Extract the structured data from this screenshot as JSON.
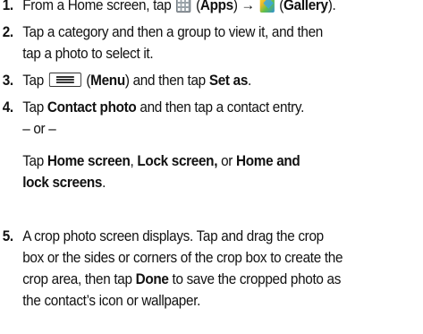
{
  "steps": [
    {
      "num": "1.",
      "lines": [
        "From a Home screen, tap",
        "(Apps) →",
        "(Gallery)."
      ],
      "apps": "Apps",
      "gallery": "Gallery"
    },
    {
      "num": "2.",
      "line1": "Tap a category and then a group to view it, and then",
      "line2": "tap a photo to select it."
    },
    {
      "num": "3.",
      "pre": "Tap",
      "menu": "Menu",
      "post": "and then tap",
      "set_as": "Set as"
    },
    {
      "num": "4.",
      "pre": "Tap",
      "contact_photo": "Contact photo",
      "post": "and then tap a contact entry.",
      "or": "– or –",
      "alt_pre": "Tap",
      "home_screen": "Home screen",
      "lock_screen": "Lock screen,",
      "or_word": "or",
      "home_lock_1": "Home and",
      "home_lock_2": "lock screens"
    },
    {
      "num": "5.",
      "l1": "A crop photo screen displays. Tap and drag the crop",
      "l2": "box or the sides or corners of the crop box to create the",
      "l3_pre": "crop area, then tap",
      "done": "Done",
      "l3_post": "to save the cropped photo as",
      "l4": "the contact’s icon or wallpaper."
    }
  ]
}
